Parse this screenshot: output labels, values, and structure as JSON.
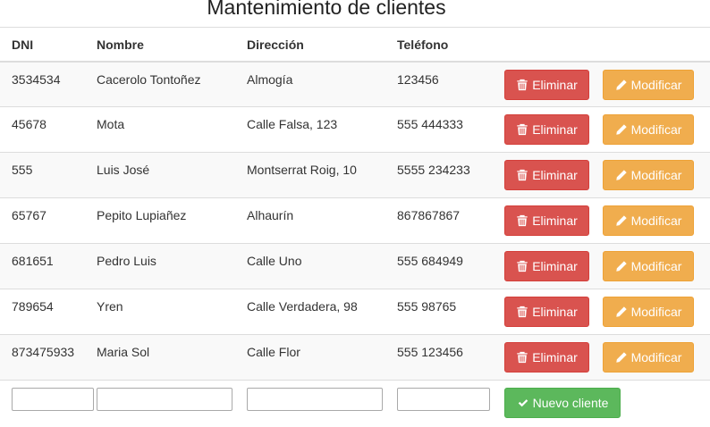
{
  "page": {
    "title": "Mantenimiento de clientes"
  },
  "table": {
    "headers": {
      "dni": "DNI",
      "nombre": "Nombre",
      "direccion": "Dirección",
      "telefono": "Teléfono"
    },
    "rows": [
      {
        "dni": "3534534",
        "nombre": "Cacerolo Tontoñez",
        "direccion": "Almogía",
        "telefono": "123456"
      },
      {
        "dni": "45678",
        "nombre": "Mota",
        "direccion": "Calle Falsa, 123",
        "telefono": "555 444333"
      },
      {
        "dni": "555",
        "nombre": "Luis José",
        "direccion": "Montserrat Roig, 10",
        "telefono": "5555 234233"
      },
      {
        "dni": "65767",
        "nombre": "Pepito Lupiañez",
        "direccion": "Alhaurín",
        "telefono": "867867867"
      },
      {
        "dni": "681651",
        "nombre": "Pedro Luis",
        "direccion": "Calle Uno",
        "telefono": "555 684949"
      },
      {
        "dni": "789654",
        "nombre": "Yren",
        "direccion": "Calle Verdadera, 98",
        "telefono": "555 98765"
      },
      {
        "dni": "873475933",
        "nombre": "Maria Sol",
        "direccion": "Calle Flor",
        "telefono": "555 123456"
      }
    ]
  },
  "actions": {
    "delete_label": "Eliminar",
    "modify_label": "Modificar",
    "new_client_label": "Nuevo cliente"
  },
  "new_client_form": {
    "dni": "",
    "nombre": "",
    "direccion": "",
    "telefono": ""
  },
  "icons": {
    "delete": "trash-icon",
    "modify": "pencil-icon",
    "new": "checkmark-icon"
  },
  "colors": {
    "danger": "#d9534f",
    "warning": "#f0ad4e",
    "success": "#5cb85c",
    "striped_row": "#f9f9f9",
    "border": "#dddddd"
  }
}
